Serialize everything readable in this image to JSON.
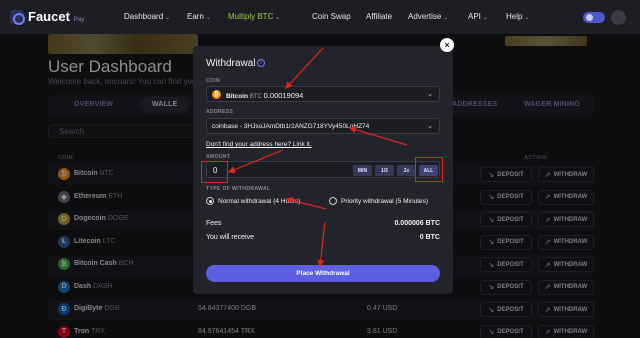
{
  "nav": {
    "logo": "Faucet",
    "logo_sub": "Pay",
    "items": [
      {
        "label": "Dashboard",
        "dropdown": true
      },
      {
        "label": "Earn",
        "dropdown": true
      },
      {
        "label": "Multiply BTC",
        "dropdown": true
      },
      {
        "label": "Coin Swap",
        "dropdown": false
      },
      {
        "label": "Affiliate",
        "dropdown": false
      },
      {
        "label": "Advertise",
        "dropdown": true
      },
      {
        "label": "API",
        "dropdown": true
      },
      {
        "label": "Help",
        "dropdown": true
      }
    ]
  },
  "dashboard": {
    "title": "User Dashboard",
    "subtitle": "Welcome back, ancuars! You can find your",
    "tabs": [
      "OVERVIEW",
      "WALLE",
      "ADDRESSES",
      "WAGER MINING"
    ],
    "search_placeholder": "Search",
    "columns": {
      "coin": "COIN",
      "action": "ACTION"
    },
    "deposit_label": "DEPOSIT",
    "withdraw_label": "WITHDRAW",
    "rows": [
      {
        "name": "Bitcoin",
        "ticker": "BTC",
        "balance": "",
        "usd": "",
        "color": "#f7931a",
        "glyph": "₿"
      },
      {
        "name": "Ethereum",
        "ticker": "ETH",
        "balance": "",
        "usd": "",
        "color": "#6b7280",
        "glyph": "◆"
      },
      {
        "name": "Dogecoin",
        "ticker": "DOGE",
        "balance": "",
        "usd": "",
        "color": "#c2a633",
        "glyph": "D"
      },
      {
        "name": "Litecoin",
        "ticker": "LTC",
        "balance": "",
        "usd": "",
        "color": "#345d9d",
        "glyph": "Ł"
      },
      {
        "name": "Bitcoin Cash",
        "ticker": "BCH",
        "balance": "",
        "usd": "",
        "color": "#4cae4c",
        "glyph": "₿"
      },
      {
        "name": "Dash",
        "ticker": "DASH",
        "balance": "",
        "usd": "",
        "color": "#1c75bc",
        "glyph": "D"
      },
      {
        "name": "DigiByte",
        "ticker": "DGB",
        "balance": "54.84377400 DGB",
        "usd": "0.47 USD",
        "color": "#0066cc",
        "glyph": "Ð"
      },
      {
        "name": "Tron",
        "ticker": "TRX",
        "balance": "84.97641454 TRX",
        "usd": "3.81 USD",
        "color": "#ef0027",
        "glyph": "T"
      }
    ]
  },
  "modal": {
    "title": "Withdrawal",
    "coin_label": "COIN",
    "coin_name": "Bitcoin",
    "coin_ticker": "BTC",
    "coin_balance": "0.00019094",
    "address_label": "ADDRESS",
    "address_value": "coinbase - 3HJsoJAmDtb1r2ANZG718YVy450LoHZ74",
    "link_text": "Don't find your address here? Link it.",
    "amount_label": "AMOUNT",
    "amount_value": "0",
    "quick_buttons": [
      "MIN",
      "1/2",
      "2x",
      "ALL"
    ],
    "type_label": "TYPE OF WITHDRAWAL",
    "type_options": [
      {
        "label": "Normal withdrawal (4 Hours)",
        "selected": true
      },
      {
        "label": "Priority withdrawal (5 Minutes)",
        "selected": false
      }
    ],
    "fees_label": "Fees",
    "fees_value": "0.000006 BTC",
    "receive_label": "You will receive",
    "receive_value": "0 BTC",
    "submit_label": "Place Withdrawal"
  },
  "colors": {
    "accent": "#5b5fe0",
    "nav_highlight": "#9ccc3c",
    "annotation": "#e0261c"
  }
}
